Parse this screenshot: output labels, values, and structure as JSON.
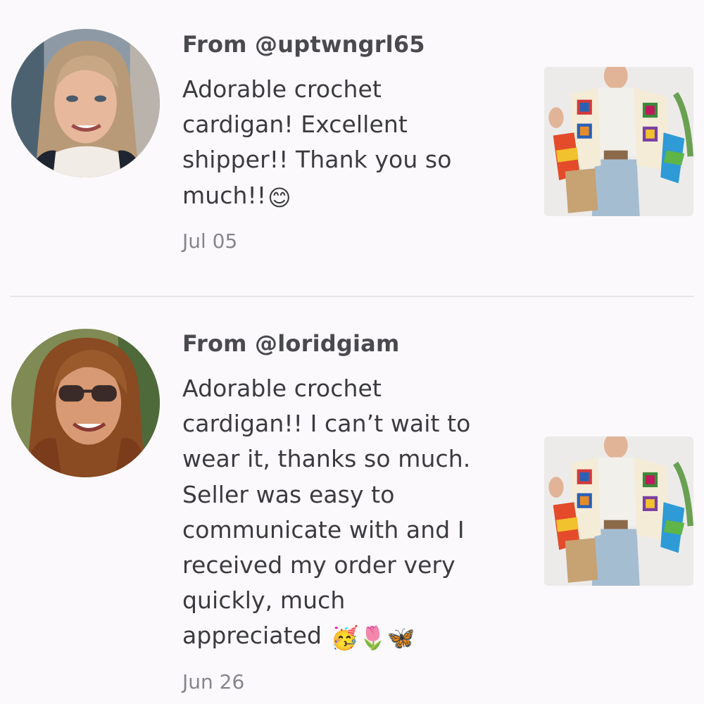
{
  "reviews": [
    {
      "from": "From @uptwngrl65",
      "text": "Adorable crochet cardigan! Excellent shipper!! Thank you so much!!",
      "emoji": "😊",
      "date": "Jul 05"
    },
    {
      "from": "From @loridgiam",
      "text": "Adorable crochet cardigan!! I can’t wait to wear it, thanks so much. Seller was easy to communicate with and I received my order very quickly, much appreciated",
      "emoji": "🥳🌷🦋",
      "date": "Jun 26"
    }
  ],
  "colors": {
    "background": "#fbf9fb",
    "username": "#4a4a4e",
    "review_text": "#3b3b3f",
    "date": "#86858b",
    "divider": "#e8e5e8"
  }
}
